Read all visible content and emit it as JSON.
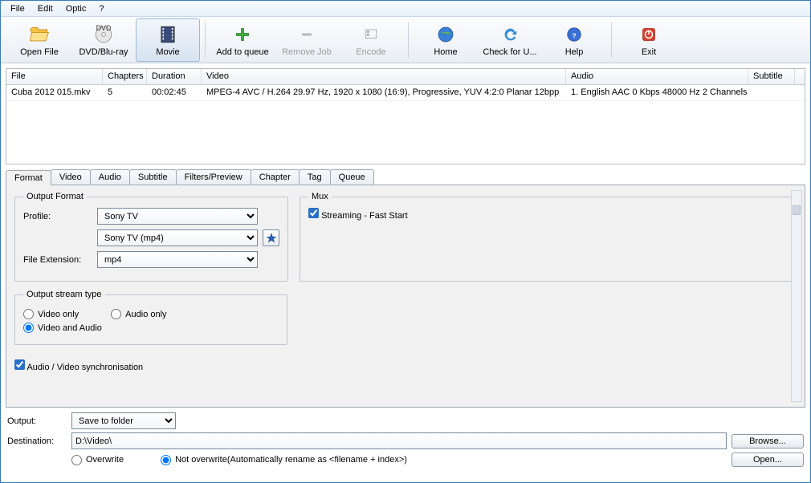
{
  "menu": {
    "file": "File",
    "edit": "Edit",
    "options": "Optic",
    "help": "?"
  },
  "toolbar": {
    "open_file": "Open File",
    "dvd": "DVD/Blu-ray",
    "movie": "Movie",
    "add_queue": "Add to queue",
    "remove_job": "Remove Job",
    "encode": "Encode",
    "home": "Home",
    "check_update": "Check for U...",
    "help": "Help",
    "exit": "Exit"
  },
  "table": {
    "headers": {
      "file": "File",
      "chapters": "Chapters",
      "duration": "Duration",
      "video": "Video",
      "audio": "Audio",
      "subtitle": "Subtitle"
    },
    "rows": [
      {
        "file": "Cuba 2012 015.mkv",
        "chapters": "5",
        "duration": "00:02:45",
        "video": "MPEG-4 AVC / H.264 29.97 Hz, 1920 x 1080 (16:9), Progressive, YUV 4:2:0 Planar 12bpp",
        "audio": "1. English AAC  0 Kbps 48000 Hz 2 Channels",
        "subtitle": ""
      }
    ]
  },
  "tabs": {
    "format": "Format",
    "video": "Video",
    "audio": "Audio",
    "subtitle": "Subtitle",
    "filters": "Filters/Preview",
    "chapter": "Chapter",
    "tag": "Tag",
    "queue": "Queue"
  },
  "format_panel": {
    "output_format_legend": "Output Format",
    "profile_label": "Profile:",
    "profile_value": "Sony TV",
    "profile2_value": "Sony TV (mp4)",
    "file_ext_label": "File Extension:",
    "file_ext_value": "mp4",
    "mux_legend": "Mux",
    "streaming_label": "Streaming - Fast Start",
    "stream_type_legend": "Output stream type",
    "video_only": "Video only",
    "audio_only": "Audio only",
    "video_and_audio": "Video and Audio",
    "av_sync": "Audio / Video synchronisation"
  },
  "bottom": {
    "output_label": "Output:",
    "output_value": "Save to folder",
    "dest_label": "Destination:",
    "dest_value": "D:\\Video\\",
    "browse": "Browse...",
    "open": "Open...",
    "overwrite": "Overwrite",
    "not_overwrite": "Not overwrite(Automatically rename as <filename + index>)"
  }
}
